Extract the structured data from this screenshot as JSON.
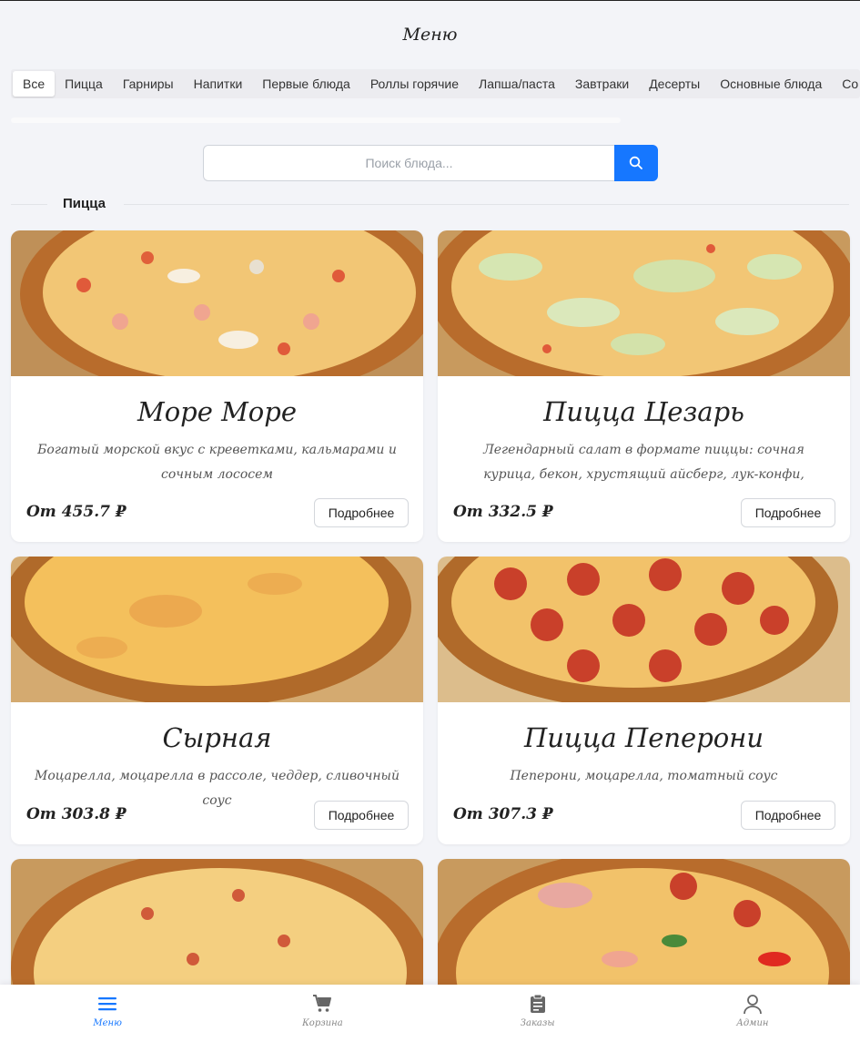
{
  "page_title": "Меню",
  "categories": [
    "Все",
    "Пицца",
    "Гарниры",
    "Напитки",
    "Первые блюда",
    "Роллы горячие",
    "Лапша/паста",
    "Завтраки",
    "Десерты",
    "Основные блюда",
    "Со"
  ],
  "active_category": "Все",
  "search": {
    "placeholder": "Поиск блюда...",
    "button_icon": "search-icon"
  },
  "section": {
    "title": "Пицца"
  },
  "cards": [
    {
      "title": "Море Море",
      "description": "Богатый морской вкус с креветками, кальмарами и сочным лососем",
      "price": "От 455.7 ₽",
      "button": "Подробнее"
    },
    {
      "title": "Пицца Цезарь",
      "description": "Легендарный салат в формате пиццы: сочная курица, бекон, хрустящий айсберг, лук-конфи, ароматный пармезан и...",
      "price": "От 332.5 ₽",
      "button": "Подробнее"
    },
    {
      "title": "Сырная",
      "description": "Моцарелла, моцарелла в рассоле, чеддер, сливочный соус",
      "price": "От 303.8 ₽",
      "button": "Подробнее"
    },
    {
      "title": "Пицца Пеперони",
      "description": "Пеперони, моцарелла, томатный соус",
      "price": "От 307.3 ₽",
      "button": "Подробнее"
    }
  ],
  "bottom_nav": [
    {
      "label": "Меню",
      "icon": "menu-icon",
      "active": true
    },
    {
      "label": "Корзина",
      "icon": "cart-icon",
      "active": false
    },
    {
      "label": "Заказы",
      "icon": "clipboard-icon",
      "active": false
    },
    {
      "label": "Админ",
      "icon": "user-icon",
      "active": false
    }
  ],
  "colors": {
    "accent": "#1677ff",
    "background": "#f3f4f8"
  }
}
